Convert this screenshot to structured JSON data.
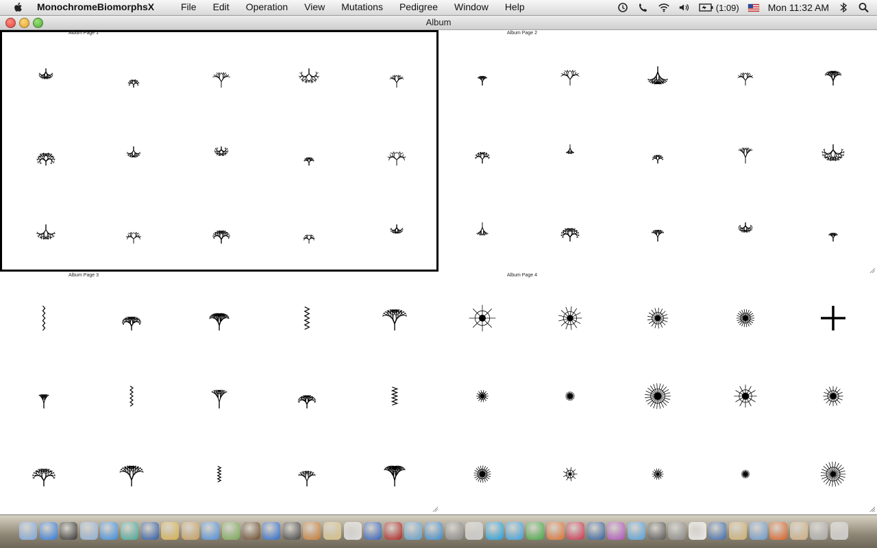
{
  "menubar": {
    "app_name": "MonochromeBiomorphsX",
    "menus": [
      "File",
      "Edit",
      "Operation",
      "View",
      "Mutations",
      "Pedigree",
      "Window",
      "Help"
    ],
    "battery": "(1:09)",
    "clock": "Mon 11:32 AM",
    "icons": [
      "time-machine-icon",
      "phone-icon",
      "wifi-icon",
      "volume-icon",
      "battery-icon",
      "flag-icon",
      "bluetooth-icon",
      "spotlight-icon"
    ]
  },
  "window": {
    "title": "Album"
  },
  "pages": [
    {
      "title": "Album Page 1",
      "selected": true
    },
    {
      "title": "Album Page 2",
      "selected": false
    },
    {
      "title": "Album Page 3",
      "selected": false
    },
    {
      "title": "Album Page 4",
      "selected": false
    }
  ],
  "dock": {
    "icons": [
      "finder-icon",
      "app-store-icon",
      "dashboard-icon",
      "preview-icon",
      "safari-icon",
      "facetime-icon",
      "xcode-icon",
      "keynote-icon",
      "contacts-icon",
      "itunes-icon",
      "iphoto-icon",
      "imovie-icon",
      "dvd-player-icon",
      "clapper-icon",
      "garageband-icon",
      "script-icon",
      "calendar-icon",
      "quicktime-icon",
      "photobooth-icon",
      "instruments-icon",
      "word-icon",
      "system-icon",
      "calculator-icon",
      "skype-icon",
      "wps-icon",
      "tree-icon",
      "pages-icon",
      "wps-writer-icon",
      "camera-icon",
      "onenote-icon",
      "people-icon",
      "time-machine-icon",
      "screenshot-icon",
      "bulb-icon",
      "home-icon",
      "folder-icon",
      "applications-icon",
      "firefox-icon",
      "document-icon",
      "downloads-icon",
      "trash-icon"
    ]
  }
}
